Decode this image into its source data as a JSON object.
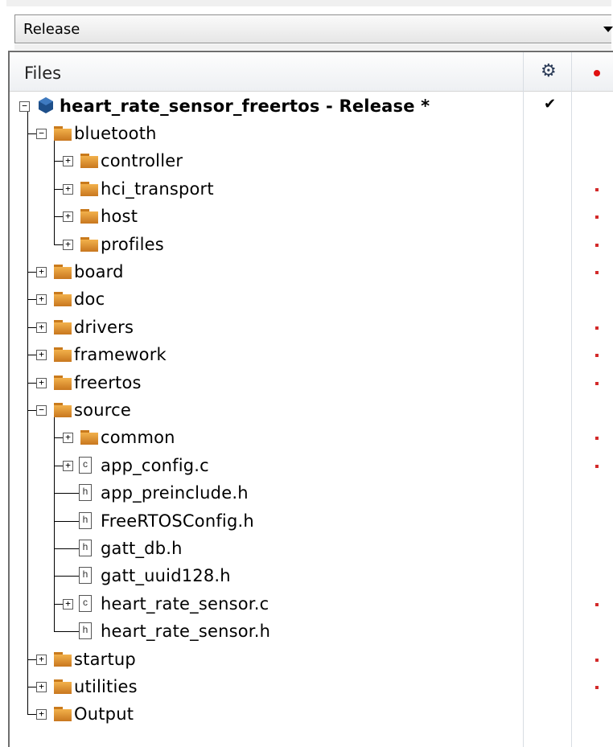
{
  "config_select": {
    "value": "Release"
  },
  "tree_header": {
    "files_label": "Files",
    "build_col_icon": "gear-icon",
    "status_col_icon": "red-dot-icon"
  },
  "tree": {
    "project": {
      "label": "heart_rate_sensor_freertos - Release *",
      "checked": true,
      "check_glyph": "✔"
    },
    "rows": [
      {
        "label": "bluetooth",
        "kind": "folder",
        "expanded": true,
        "level": 1,
        "modified": false
      },
      {
        "label": "controller",
        "kind": "folder",
        "expanded": false,
        "level": 2,
        "modified": false
      },
      {
        "label": "hci_transport",
        "kind": "folder",
        "expanded": false,
        "level": 2,
        "modified": true
      },
      {
        "label": "host",
        "kind": "folder",
        "expanded": false,
        "level": 2,
        "modified": true
      },
      {
        "label": "profiles",
        "kind": "folder",
        "expanded": false,
        "level": 2,
        "modified": true
      },
      {
        "label": "board",
        "kind": "folder",
        "expanded": false,
        "level": 1,
        "modified": true
      },
      {
        "label": "doc",
        "kind": "folder",
        "expanded": false,
        "level": 1,
        "modified": false
      },
      {
        "label": "drivers",
        "kind": "folder",
        "expanded": false,
        "level": 1,
        "modified": true
      },
      {
        "label": "framework",
        "kind": "folder",
        "expanded": false,
        "level": 1,
        "modified": true
      },
      {
        "label": "freertos",
        "kind": "folder",
        "expanded": false,
        "level": 1,
        "modified": true
      },
      {
        "label": "source",
        "kind": "folder",
        "expanded": true,
        "level": 1,
        "modified": false
      },
      {
        "label": "common",
        "kind": "folder",
        "expanded": false,
        "level": 2,
        "modified": true
      },
      {
        "label": "app_config.c",
        "kind": "c-file",
        "expanded": false,
        "level": 2,
        "modified": true
      },
      {
        "label": "app_preinclude.h",
        "kind": "h-file",
        "level": 2,
        "modified": false
      },
      {
        "label": "FreeRTOSConfig.h",
        "kind": "h-file",
        "level": 2,
        "modified": false
      },
      {
        "label": "gatt_db.h",
        "kind": "h-file",
        "level": 2,
        "modified": false
      },
      {
        "label": "gatt_uuid128.h",
        "kind": "h-file",
        "level": 2,
        "modified": false
      },
      {
        "label": "heart_rate_sensor.c",
        "kind": "c-file",
        "expanded": false,
        "level": 2,
        "modified": true
      },
      {
        "label": "heart_rate_sensor.h",
        "kind": "h-file",
        "level": 2,
        "modified": false
      },
      {
        "label": "startup",
        "kind": "folder",
        "expanded": false,
        "level": 1,
        "modified": true
      },
      {
        "label": "utilities",
        "kind": "folder",
        "expanded": false,
        "level": 1,
        "modified": true
      },
      {
        "label": "Output",
        "kind": "folder",
        "expanded": false,
        "level": 1,
        "modified": false
      }
    ]
  },
  "glyphs": {
    "c_file": "c",
    "h_file": "h",
    "expand": "+",
    "collapse": "−"
  },
  "colors": {
    "modified_mark": "#d32a2a",
    "folder": "#e9a23b",
    "project_icon": "#1e4f8a"
  }
}
